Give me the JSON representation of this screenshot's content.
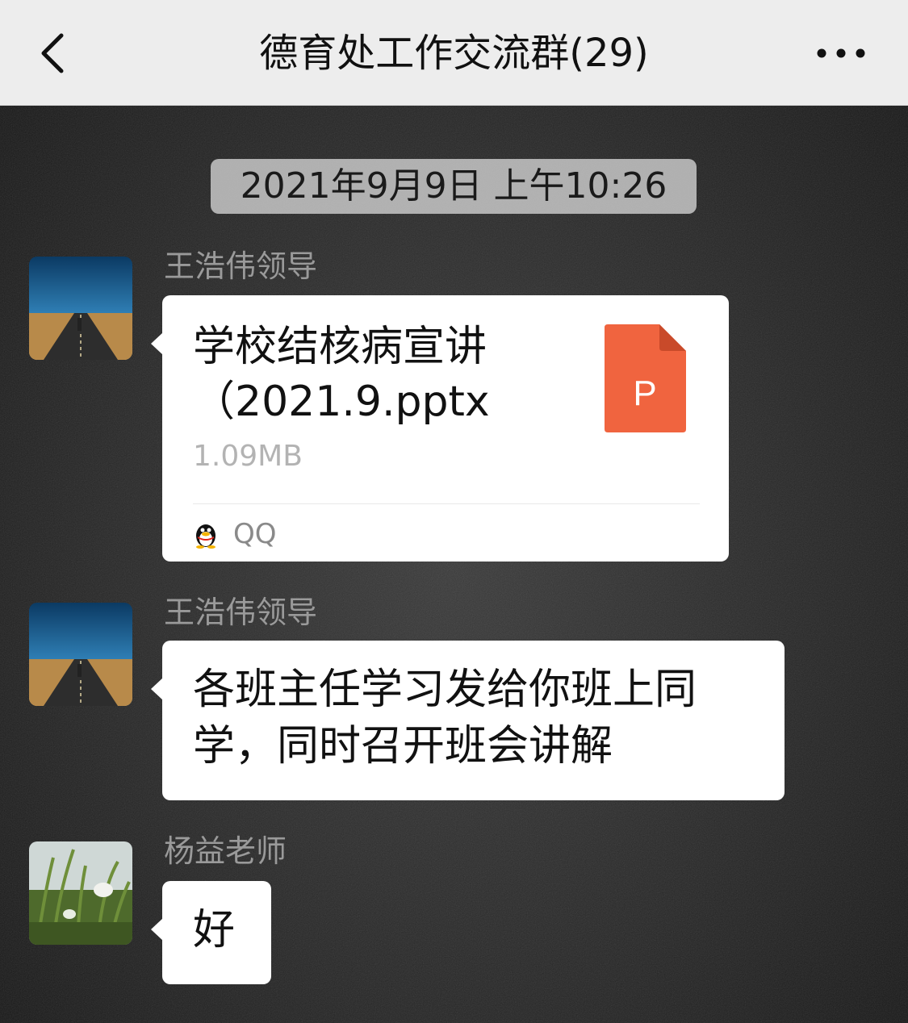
{
  "header": {
    "title": "德育处工作交流群(29)",
    "back_icon": "chevron-left-icon",
    "more_icon": "ellipsis-icon"
  },
  "timestamp": "2021年9月9日 上午10:26",
  "messages": [
    {
      "sender": "王浩伟领导",
      "type": "file",
      "file": {
        "name": "学校结核病宣讲（2021.9.pptx",
        "size": "1.09MB",
        "icon_letter": "P",
        "icon_color": "#f0643f",
        "source": "QQ"
      }
    },
    {
      "sender": "王浩伟领导",
      "type": "text",
      "text": "各班主任学习发给你班上同学，同时召开班会讲解"
    },
    {
      "sender": "杨益老师",
      "type": "text",
      "text": "好"
    }
  ],
  "colors": {
    "nav_bg": "#ededed",
    "bubble_bg": "#ffffff",
    "sender_text": "#9a9a9a"
  }
}
